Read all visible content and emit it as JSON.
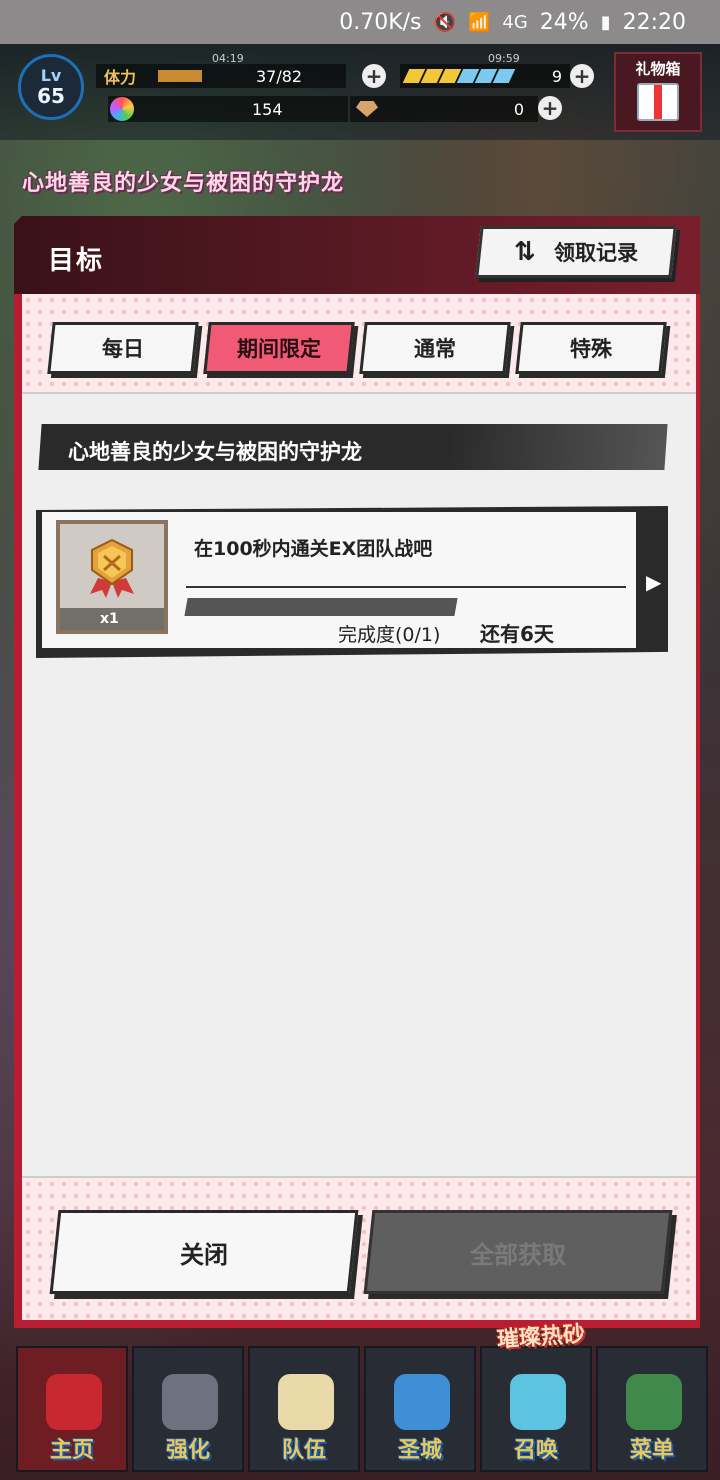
{
  "status_bar": {
    "net_speed": "0.70K/s",
    "network": "4G",
    "battery": "24%",
    "time": "22:20"
  },
  "hud": {
    "level_label": "Lv",
    "level_value": "65",
    "stamina_label": "体力",
    "stamina_timer": "04:19",
    "stamina_value": "37/82",
    "gem_count": "154",
    "wing_timer": "09:59",
    "wing_count": "9",
    "crystal_count": "0",
    "gift_label": "礼物箱"
  },
  "scene": {
    "banner": "心地善良的少女与被困的守护龙"
  },
  "dialog": {
    "title": "目标",
    "history_label": "领取记录",
    "tabs": [
      {
        "label": "每日",
        "active": false
      },
      {
        "label": "期间限定",
        "active": true
      },
      {
        "label": "通常",
        "active": false
      },
      {
        "label": "特殊",
        "active": false
      }
    ],
    "event_title": "心地善良的少女与被困的守护龙",
    "missions": [
      {
        "title": "在100秒内通关EX团队战吧",
        "reward_count": "x1",
        "progress_text": "完成度(0/1)",
        "progress_fraction": 0,
        "remaining": "还有6天"
      }
    ],
    "close_label": "关闭",
    "claim_all_label": "全部获取"
  },
  "nav": {
    "event_tag": "璀璨热砂",
    "items": [
      {
        "label": "主页"
      },
      {
        "label": "强化"
      },
      {
        "label": "队伍"
      },
      {
        "label": "圣城"
      },
      {
        "label": "召唤"
      },
      {
        "label": "菜单"
      }
    ]
  },
  "colors": {
    "accent_red": "#b91d32",
    "active_tab": "#f05a74",
    "nav_label": "#e8c85a"
  }
}
